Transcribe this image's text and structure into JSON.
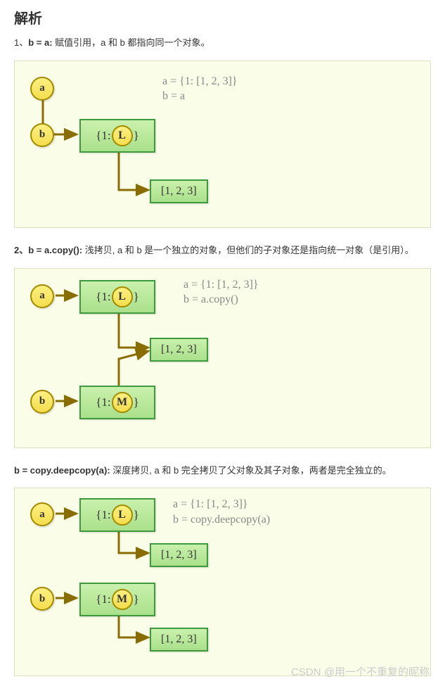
{
  "title": "解析",
  "section1": {
    "num": "1、",
    "bold": "b = a:",
    "desc": " 赋值引用，a 和 b 都指向同一个对象。",
    "code_line1": "a = {1: [1, 2, 3]}",
    "code_line2": "b = a",
    "var_a": "a",
    "var_b": "b",
    "dict_prefix": "{1:",
    "dict_inner": "L",
    "dict_suffix": "}",
    "list": "[1, 2, 3]"
  },
  "section2": {
    "num": "2、",
    "bold": "b = a.copy():",
    "desc": " 浅拷贝, a 和 b 是一个独立的对象，但他们的子对象还是指向统一对象（是引用）。",
    "code_line1": "a = {1: [1, 2, 3]}",
    "code_line2": "b = a.copy()",
    "var_a": "a",
    "var_b": "b",
    "dict1_prefix": "{1:",
    "dict1_inner": "L",
    "dict1_suffix": "}",
    "dict2_prefix": "{1:",
    "dict2_inner": "M",
    "dict2_suffix": "}",
    "list": "[1, 2, 3]"
  },
  "section3": {
    "bold": "b = copy.deepcopy(a):",
    "desc": " 深度拷贝, a 和 b 完全拷贝了父对象及其子对象，两者是完全独立的。",
    "code_line1": "a = {1: [1, 2, 3]}",
    "code_line2": "b = copy.deepcopy(a)",
    "var_a": "a",
    "var_b": "b",
    "dict1_prefix": "{1:",
    "dict1_inner": "L",
    "dict1_suffix": "}",
    "dict2_prefix": "{1:",
    "dict2_inner": "M",
    "dict2_suffix": "}",
    "list1": "[1, 2, 3]",
    "list2": "[1, 2, 3]"
  },
  "watermark": "CSDN @用一个不重复的昵称"
}
